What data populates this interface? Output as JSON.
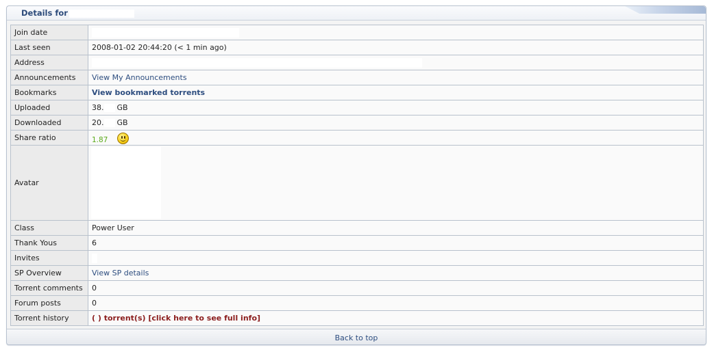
{
  "header": {
    "title": "Details for"
  },
  "rows": {
    "join_date": {
      "label": "Join date"
    },
    "last_seen": {
      "label": "Last seen",
      "value": "2008-01-02 20:44:20 (< 1 min ago)"
    },
    "address": {
      "label": "Address"
    },
    "announcements": {
      "label": "Announcements",
      "link": "View My Announcements"
    },
    "bookmarks": {
      "label": "Bookmarks",
      "link": "View bookmarked torrents"
    },
    "uploaded": {
      "label": "Uploaded",
      "value_prefix": "38.",
      "unit": "GB"
    },
    "downloaded": {
      "label": "Downloaded",
      "value_prefix": "20.",
      "unit": "GB"
    },
    "share_ratio": {
      "label": "Share ratio",
      "value": "1.87",
      "icon": "smiley-icon",
      "color": "#5aaa1a"
    },
    "avatar": {
      "label": "Avatar"
    },
    "class": {
      "label": "Class",
      "value": "Power User"
    },
    "thank_yous": {
      "label": "Thank Yous",
      "value": "6"
    },
    "invites": {
      "label": "Invites"
    },
    "sp_overview": {
      "label": "SP Overview",
      "link": "View SP details"
    },
    "torrent_comments": {
      "label": "Torrent comments",
      "value": "0"
    },
    "forum_posts": {
      "label": "Forum posts",
      "value": "0"
    },
    "torrent_history": {
      "label": "Torrent history",
      "link": "( ) torrent(s) [click here to see full info]",
      "color": "#8b1d1d"
    }
  },
  "footer": {
    "back_to_top": "Back to top"
  },
  "colors": {
    "link": "#2d4d7f",
    "title": "#2b4a7a",
    "border": "#b8c1cc"
  }
}
